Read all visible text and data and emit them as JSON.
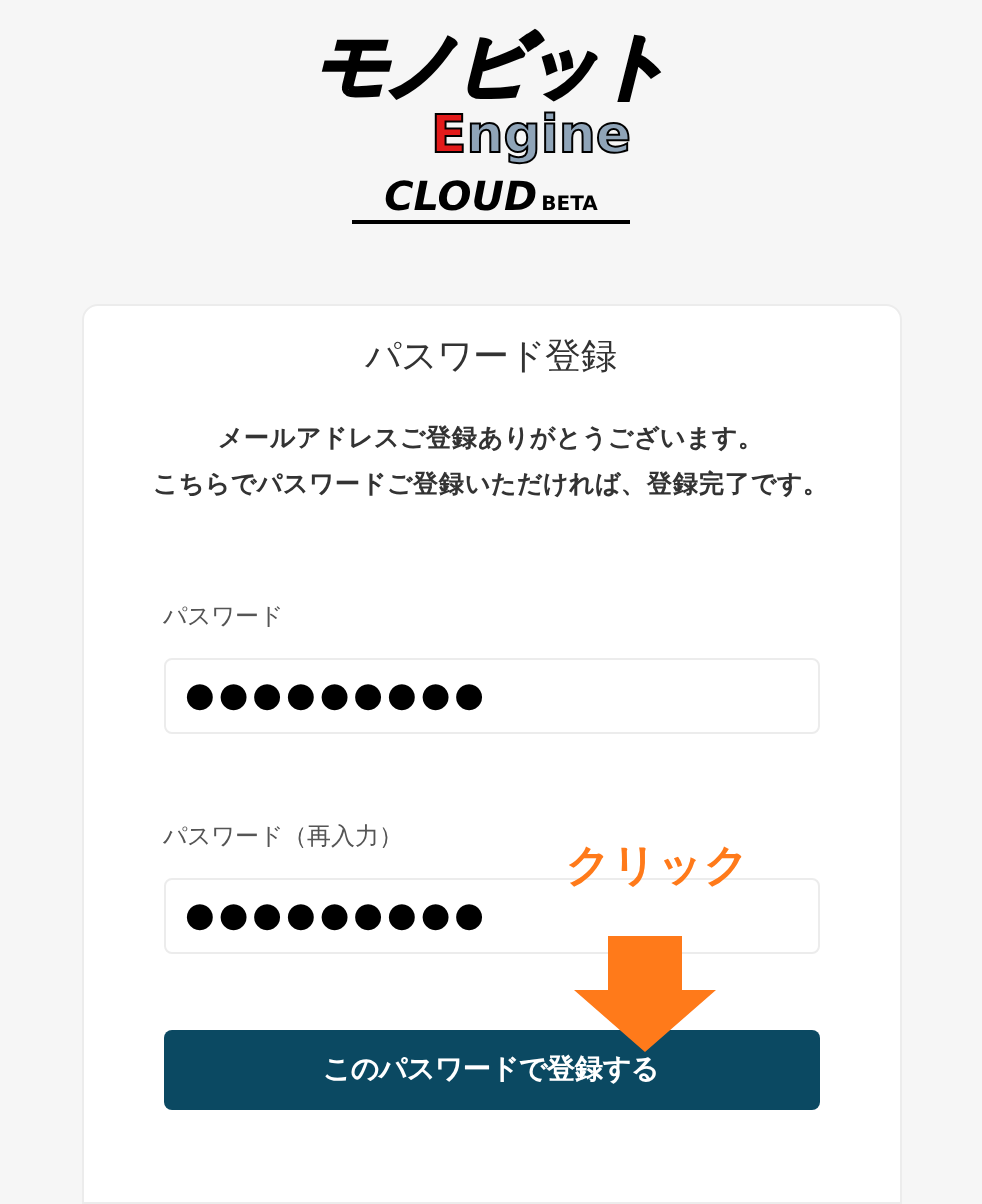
{
  "logo": {
    "katakana": "モノビット",
    "engine": "Engine",
    "cloud": "CLOUD",
    "beta": "BETA"
  },
  "form": {
    "title": "パスワード登録",
    "message_lines": [
      "メールアドレスご登録ありがとうございます。",
      "こちらでパスワードご登録いただければ、登録完了です。"
    ],
    "fields": [
      {
        "label": "パスワード",
        "value": "●●●●●●●●●"
      },
      {
        "label": "パスワード（再入力）",
        "value": "●●●●●●●●●"
      }
    ],
    "submit": "このパスワードで登録する"
  },
  "annotation": {
    "text": "クリック"
  }
}
